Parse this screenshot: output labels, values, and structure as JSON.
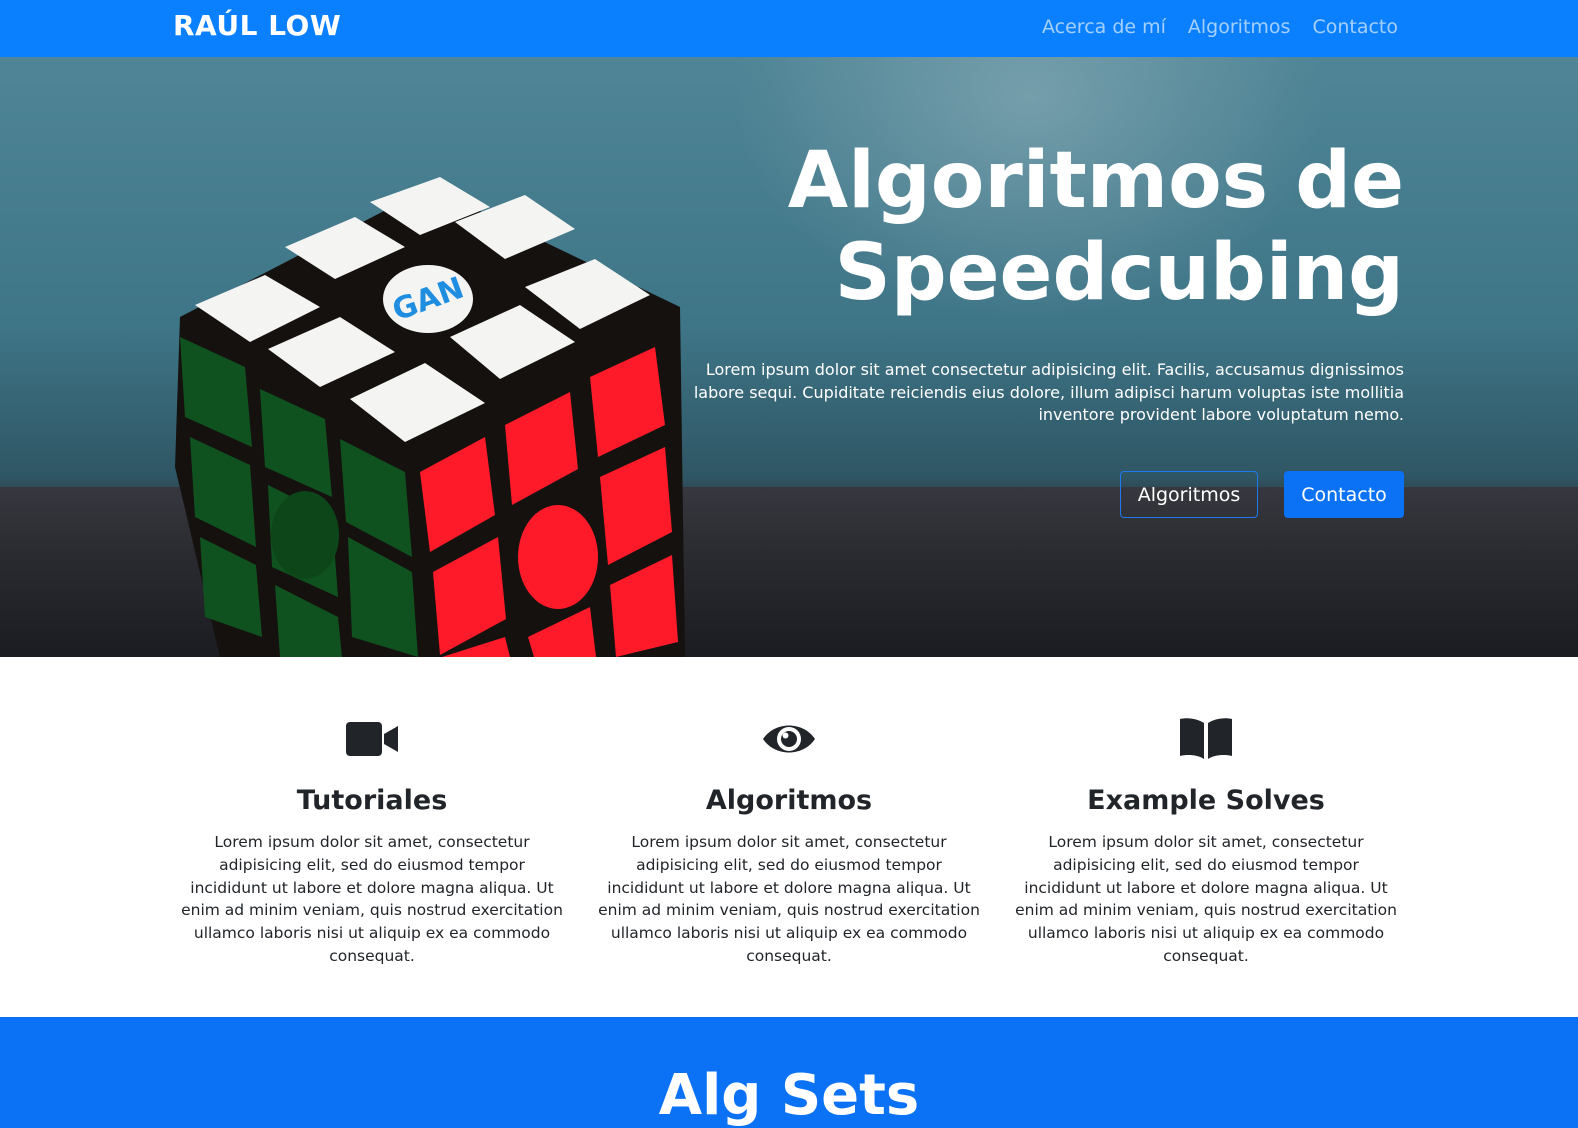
{
  "navbar": {
    "brand": "RAÚL LOW",
    "links": [
      "Acerca de mí",
      "Algoritmos",
      "Contacto"
    ]
  },
  "hero": {
    "title_line1": "Algoritmos de",
    "title_line2": "Speedcubing",
    "text": "Lorem ipsum dolor sit amet consectetur adipisicing elit. Facilis, accusamus dignissimos labore sequi. Cupiditate reiciendis eius dolore, illum adipisci harum voluptas iste mollitia inventore provident labore voluptatum nemo.",
    "buttons": {
      "secondary": "Algoritmos",
      "primary": "Contacto"
    },
    "image": "rubiks-cube-photo"
  },
  "features": [
    {
      "icon": "video-camera-icon",
      "title": "Tutoriales",
      "text": "Lorem ipsum dolor sit amet, consectetur adipisicing elit, sed do eiusmod tempor incididunt ut labore et dolore magna aliqua. Ut enim ad minim veniam, quis nostrud exercitation ullamco laboris nisi ut aliquip ex ea commodo consequat."
    },
    {
      "icon": "eye-icon",
      "title": "Algoritmos",
      "text": "Lorem ipsum dolor sit amet, consectetur adipisicing elit, sed do eiusmod tempor incididunt ut labore et dolore magna aliqua. Ut enim ad minim veniam, quis nostrud exercitation ullamco laboris nisi ut aliquip ex ea commodo consequat."
    },
    {
      "icon": "book-open-icon",
      "title": "Example Solves",
      "text": "Lorem ipsum dolor sit amet, consectetur adipisicing elit, sed do eiusmod tempor incididunt ut labore et dolore magna aliqua. Ut enim ad minim veniam, quis nostrud exercitation ullamco laboris nisi ut aliquip ex ea commodo consequat."
    }
  ],
  "algsets": {
    "title": "Alg Sets"
  },
  "colors": {
    "primary": "#0b72f5",
    "navbar": "#0b80ff",
    "text": "#212529"
  }
}
